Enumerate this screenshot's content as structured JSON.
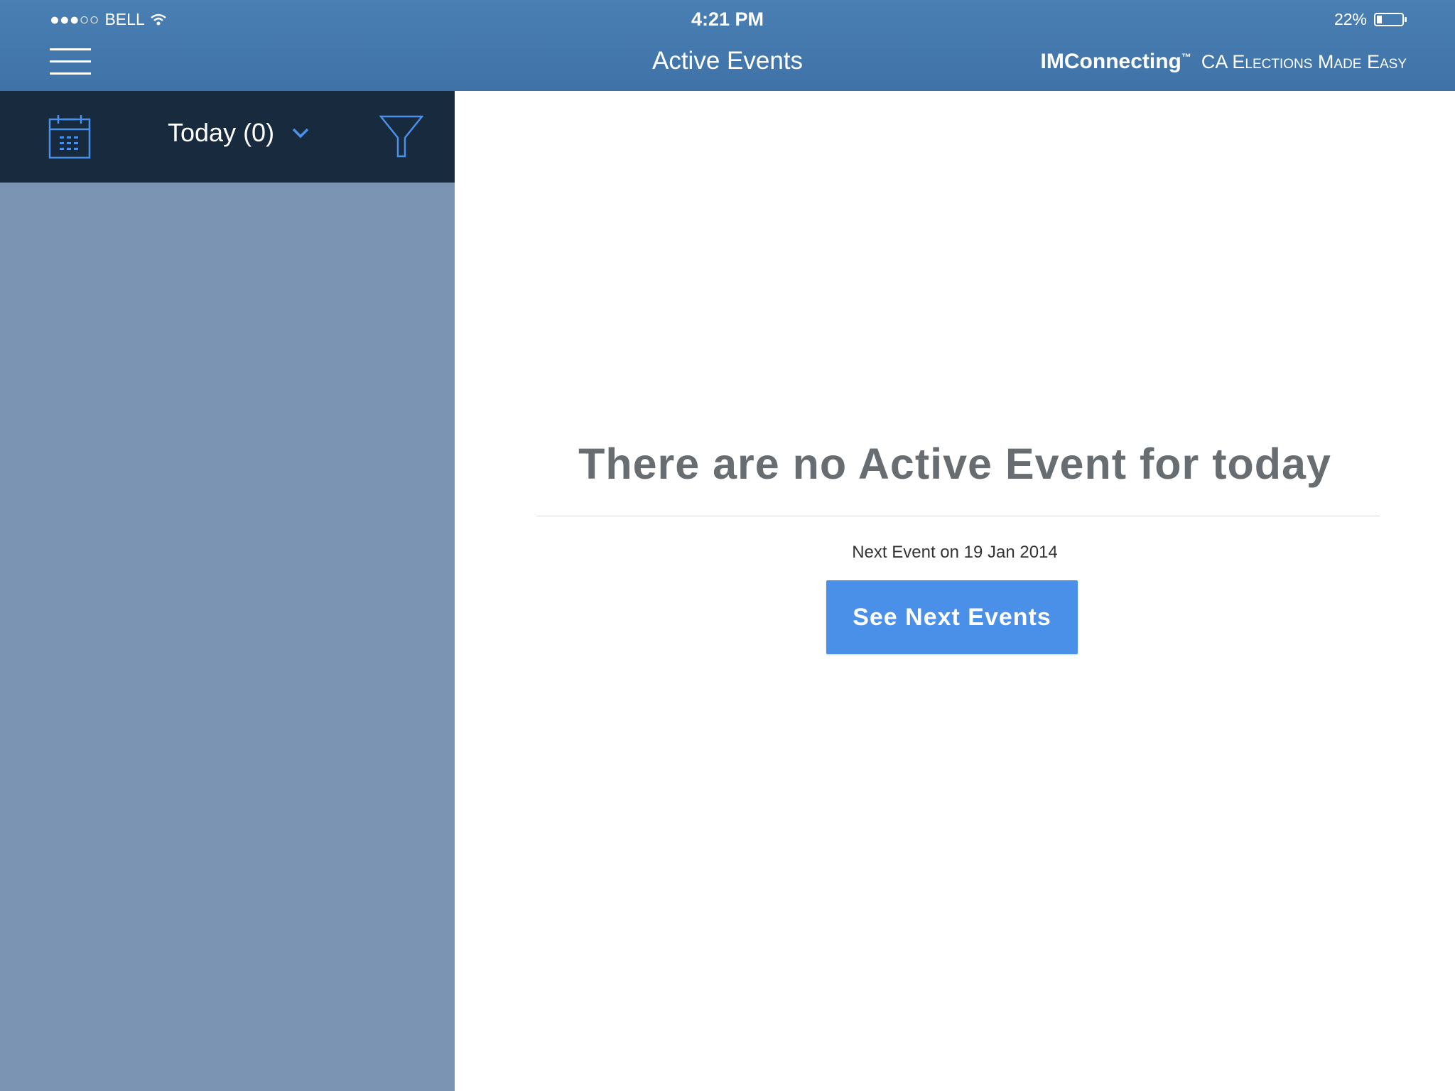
{
  "status_bar": {
    "carrier": "BELL",
    "signal_icon": "signal-dots-icon",
    "wifi_icon": "wifi-icon",
    "time": "4:21 PM",
    "battery_text": "22%",
    "battery_level": 0.22
  },
  "nav_bar": {
    "menu_icon": "hamburger-menu-icon",
    "title": "Active Events",
    "brand_name": "IMConnecting",
    "brand_trademark": "™",
    "brand_tagline": "CA Elections Made Easy"
  },
  "sidebar": {
    "calendar_icon": "calendar-icon",
    "filter_label": "Today (0)",
    "dropdown_icon": "chevron-down-icon",
    "filter_icon": "filter-funnel-icon"
  },
  "main": {
    "empty_message": "There are no Active Event for today",
    "next_event_text": "Next Event on 19 Jan 2014",
    "next_button_label": "See Next Events"
  },
  "colors": {
    "nav_bar": "#4277ac",
    "sidebar_header": "#172a3e",
    "sidebar": "#7b94b3",
    "accent": "#4a90e8",
    "empty_text": "#686d72"
  }
}
